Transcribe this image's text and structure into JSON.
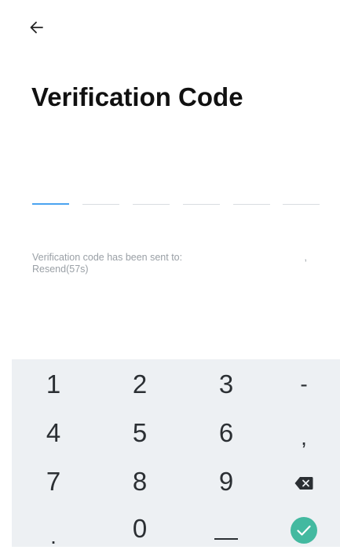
{
  "header": {
    "title": "Verification Code"
  },
  "code": {
    "digits": [
      "",
      "",
      "",
      "",
      "",
      ""
    ]
  },
  "info": {
    "sent_text": "Verification code has been sent to:",
    "comma": ",",
    "resend_label": "Resend(57s)"
  },
  "keyboard": {
    "accent_color": "#43b9a0",
    "rows": [
      [
        "1",
        "2",
        "3",
        "-"
      ],
      [
        "4",
        "5",
        "6",
        ","
      ],
      [
        "7",
        "8",
        "9",
        "backspace-icon"
      ],
      [
        ".",
        "0",
        "space",
        "check-icon"
      ]
    ]
  }
}
